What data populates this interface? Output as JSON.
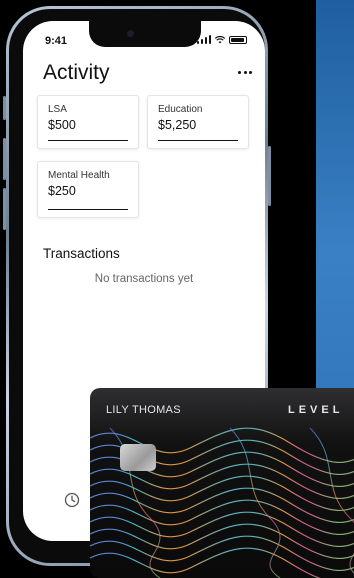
{
  "status_bar": {
    "time": "9:41"
  },
  "header": {
    "title": "Activity"
  },
  "accounts": [
    {
      "label": "LSA",
      "amount": "$500"
    },
    {
      "label": "Education",
      "amount": "$5,250"
    },
    {
      "label": "Mental Health",
      "amount": "$250"
    }
  ],
  "transactions": {
    "title": "Transactions",
    "empty_message": "No transactions yet"
  },
  "card": {
    "holder": "LILY THOMAS",
    "brand": "LEVEL"
  },
  "colors": {
    "background_accent": "#2c6fb6",
    "text_primary": "#111111"
  },
  "icons": [
    "more-icon",
    "clock-icon",
    "chip-icon",
    "signal-icon",
    "wifi-icon",
    "battery-icon"
  ]
}
